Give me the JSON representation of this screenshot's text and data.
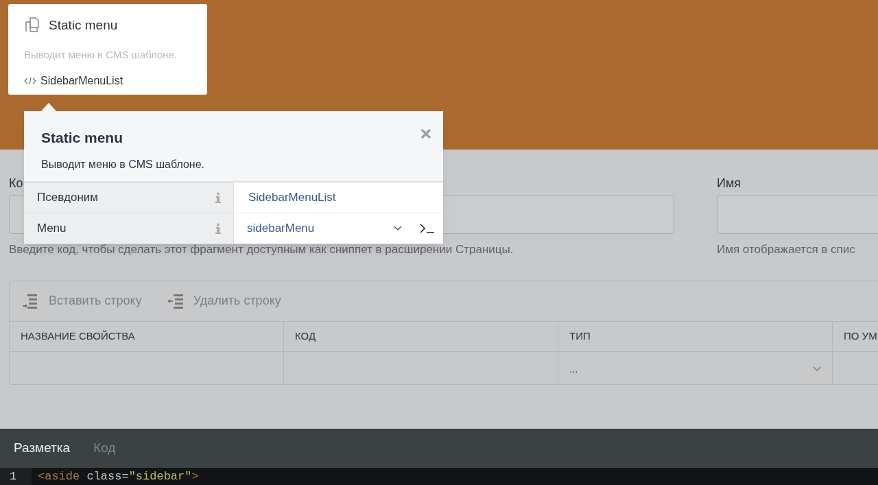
{
  "component_card": {
    "title": "Static menu",
    "description": "Выводит меню в CMS шаблоне.",
    "alias": "SidebarMenuList"
  },
  "inspector": {
    "title": "Static menu",
    "description": "Выводит меню в CMS шаблоне.",
    "properties": [
      {
        "kind": "text",
        "label": "Псевдоним",
        "value": "SidebarMenuList"
      },
      {
        "kind": "dropdown",
        "label": "Menu",
        "value": "sidebarMenu"
      }
    ]
  },
  "form": {
    "fields": [
      {
        "label": "Ко",
        "hint": "Введите код, чтобы сделать этот фрагмент доступным как сниппет в расширении Страницы."
      },
      {
        "label": "Имя",
        "hint": "Имя отображается в спис"
      }
    ]
  },
  "toolbar": [
    {
      "kind": "insert",
      "label": "Вставить строку"
    },
    {
      "kind": "delete",
      "label": "Удалить строку"
    }
  ],
  "table": {
    "columns": [
      "НАЗВАНИЕ СВОЙСТВА",
      "КОД",
      "ТИП",
      "ПО УМ"
    ],
    "rows": [
      [
        {
          "kind": "empty"
        },
        {
          "kind": "empty"
        },
        {
          "kind": "select",
          "value": "..."
        },
        {
          "kind": "empty"
        }
      ]
    ]
  },
  "editor": {
    "tabs": [
      {
        "label": "Разметка",
        "selected": true
      },
      {
        "label": "Код",
        "selected": false
      }
    ],
    "lines": [
      {
        "number": "1",
        "tokens": [
          {
            "kind": "tag",
            "text": "<aside"
          },
          {
            "kind": "attr",
            "text": " class="
          },
          {
            "kind": "string",
            "text": "\"sidebar\""
          },
          {
            "kind": "tag",
            "text": ">"
          }
        ]
      }
    ]
  }
}
